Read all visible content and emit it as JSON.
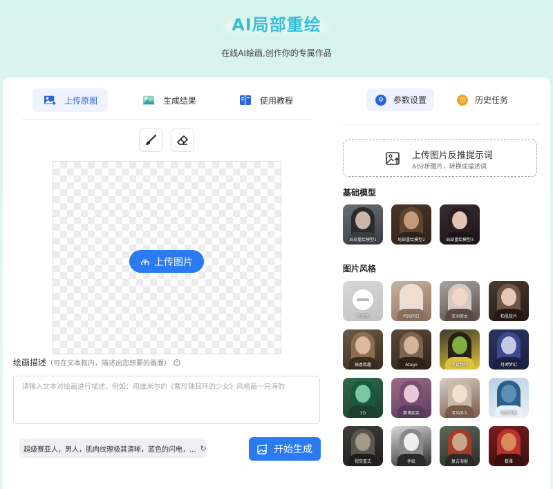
{
  "header": {
    "title": "AI局部重绘",
    "subtitle": "在线AI绘画,创作你的专属作品"
  },
  "left_tabs": [
    {
      "label": "上传原图",
      "icon": "image-upload-icon",
      "active": true
    },
    {
      "label": "生成结果",
      "icon": "landscape-icon",
      "active": false
    },
    {
      "label": "使用教程",
      "icon": "book-icon",
      "active": false
    }
  ],
  "tools": {
    "brush_icon": "brush-icon",
    "eraser_icon": "eraser-icon"
  },
  "canvas": {
    "upload_label": "上传图片"
  },
  "description": {
    "label": "绘画描述",
    "hint": "（可在文本框内，描述出您想要的画面）",
    "placeholder": "请输入文本对绘画进行描述，例如：用维米尔的《戴珍珠耳环的少女》风格画一只海豹"
  },
  "prompt_chip": "超级赛亚人，男人，肌肉纹理极其清晰，蓝色的闪电，...",
  "generate_label": "开始生成",
  "right_tabs": [
    {
      "label": "参数设置",
      "icon": "settings-icon",
      "active": true,
      "color": "#2a66d9"
    },
    {
      "label": "历史任务",
      "icon": "clock-icon",
      "active": false,
      "color": "#f0a623"
    }
  ],
  "reverse_prompt": {
    "title": "上传图片反推提示词",
    "subtitle": "AI分析图片，转换成描述词"
  },
  "base_model": {
    "title": "基础模型",
    "items": [
      "局部重绘模型1",
      "局部重绘模型2",
      "局部重绘模型3"
    ]
  },
  "style": {
    "title": "图片风格",
    "items": [
      "不使用",
      "韩国网红",
      "亚洲美女",
      "柏肌胶片",
      "插香数趣",
      "Atago",
      "美食静物",
      "月岬梦幻",
      "3D",
      "赛博朋克",
      "清纯美女",
      "电商风影",
      "视觉重式",
      "手绘",
      "复古海报",
      "数雅"
    ]
  }
}
